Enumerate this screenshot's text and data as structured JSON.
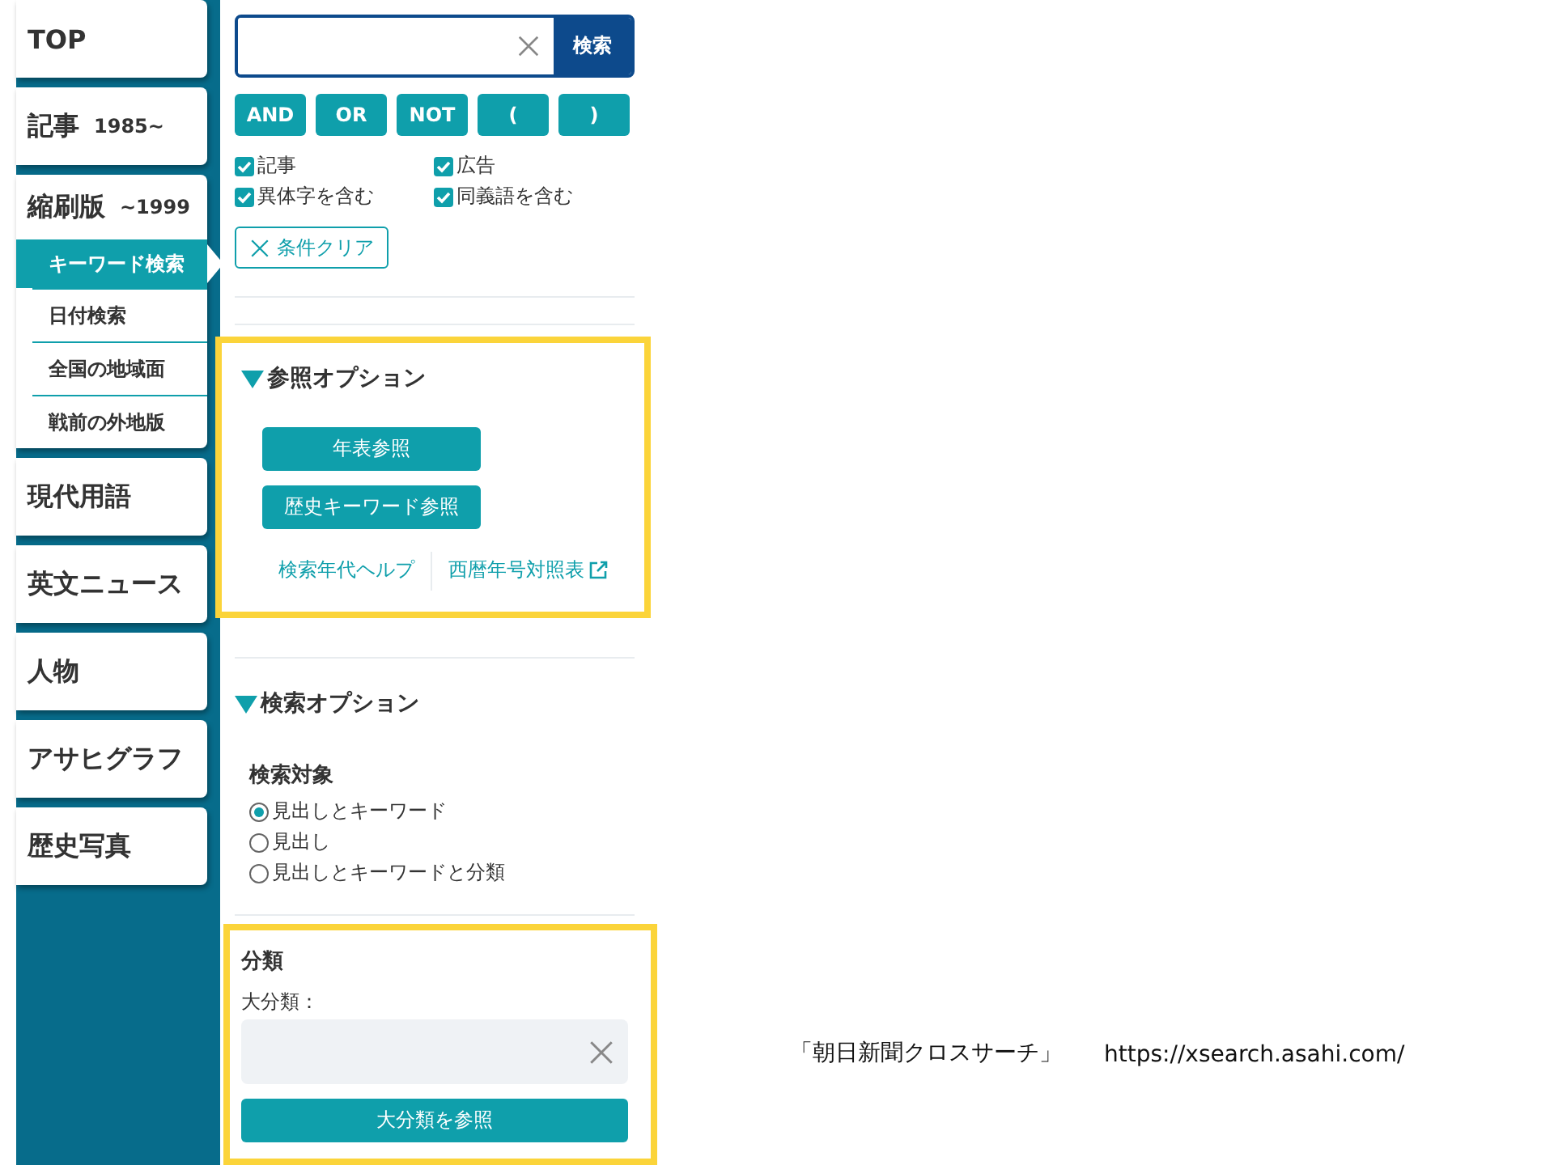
{
  "sidebar": {
    "items": [
      {
        "label": "TOP",
        "expanded": false
      },
      {
        "label": "記事",
        "note": "1985~",
        "expanded": false
      },
      {
        "label": "縮刷版",
        "note": "~1999",
        "expanded": true,
        "children": [
          {
            "label": "キーワード検索",
            "selected": true
          },
          {
            "label": "日付検索",
            "selected": false
          },
          {
            "label": "全国の地域面",
            "selected": false
          },
          {
            "label": "戦前の外地版",
            "selected": false
          }
        ]
      },
      {
        "label": "現代用語",
        "expanded": false
      },
      {
        "label": "英文ニュース",
        "expanded": false
      },
      {
        "label": "人物",
        "expanded": false
      },
      {
        "label": "アサヒグラフ",
        "expanded": false
      },
      {
        "label": "歴史写真",
        "expanded": false
      }
    ]
  },
  "search": {
    "button": "検索"
  },
  "operators": [
    "AND",
    "OR",
    "NOT",
    "(",
    ")"
  ],
  "checks": [
    {
      "label": "記事",
      "checked": true
    },
    {
      "label": "広告",
      "checked": true
    },
    {
      "label": "異体字を含む",
      "checked": true
    },
    {
      "label": "同義語を含む",
      "checked": true
    }
  ],
  "clear_button": "条件クリア",
  "reference_options": {
    "title": "参照オプション",
    "expanded": true,
    "highlighted": true,
    "buttons": [
      "年表参照",
      "歴史キーワード参照"
    ],
    "links": [
      {
        "label": "検索年代ヘルプ",
        "external": false
      },
      {
        "label": "西暦年号対照表",
        "external": true
      }
    ]
  },
  "search_options": {
    "title": "検索オプション",
    "expanded": true,
    "target_label": "検索対象",
    "radios": [
      {
        "label": "見出しとキーワード",
        "selected": true
      },
      {
        "label": "見出し",
        "selected": false
      },
      {
        "label": "見出しとキーワードと分類",
        "selected": false
      }
    ]
  },
  "classification": {
    "title": "分類",
    "highlighted": true,
    "field_label": "大分類：",
    "button": "大分類を参照"
  },
  "caption": {
    "name": "「朝日新聞クロスサーチ」",
    "url": "https://xsearch.asahi.com/"
  }
}
